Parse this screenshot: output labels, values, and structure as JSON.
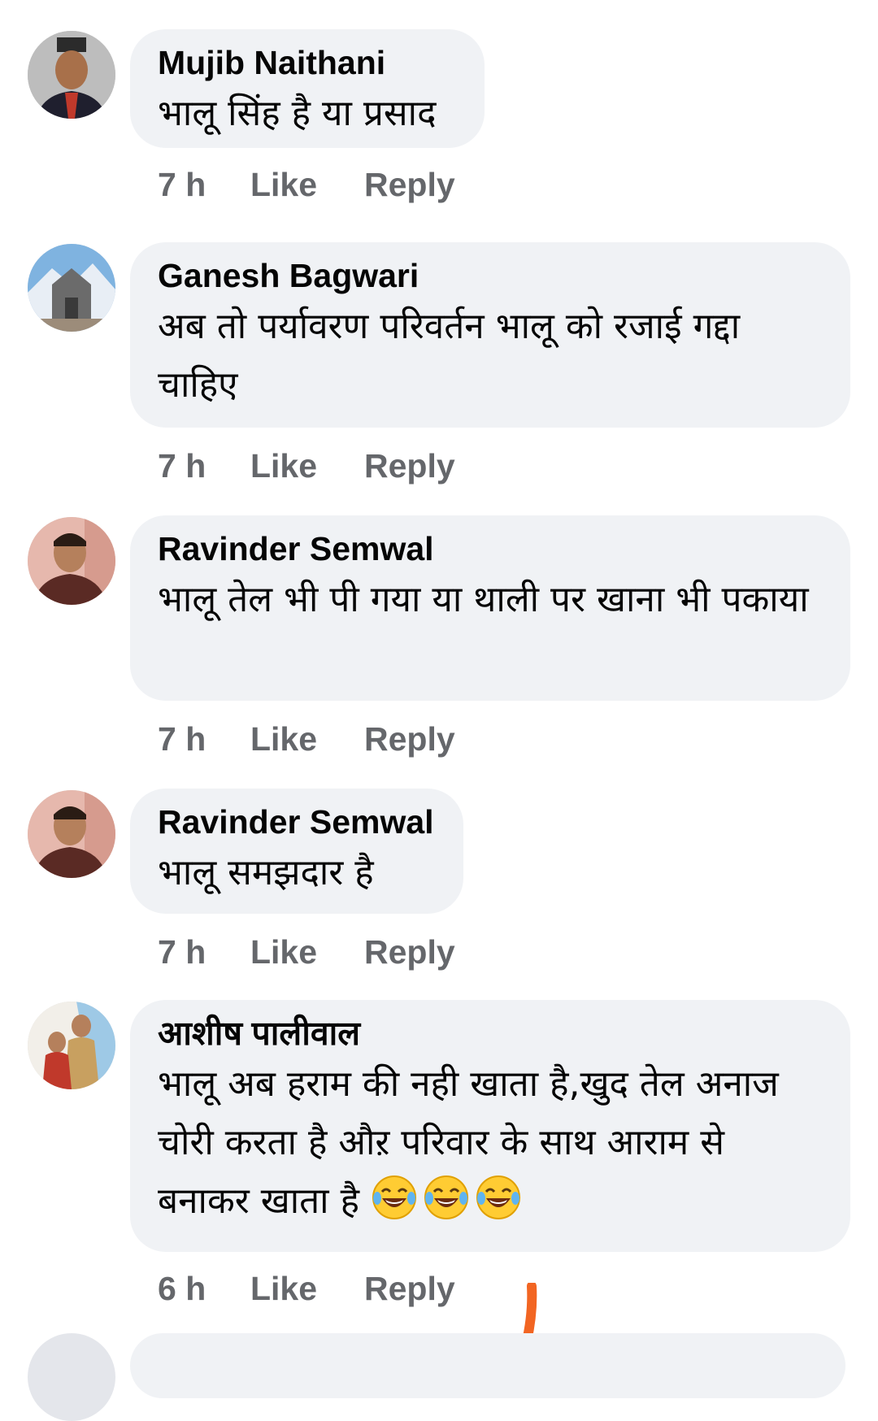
{
  "comments": [
    {
      "author": "Mujib Naithani",
      "text": "भालू सिंह है या प्रसाद",
      "time": "7 h",
      "like": "Like",
      "reply": "Reply"
    },
    {
      "author": "Ganesh Bagwari",
      "text": "अब तो पर्यावरण परिवर्तन भालू को रजाई गद्दा चाहिए",
      "time": "7 h",
      "like": "Like",
      "reply": "Reply"
    },
    {
      "author": "Ravinder Semwal",
      "text": "भालू तेल भी पी गया या थाली पर खाना भी पकाया",
      "time": "7 h",
      "like": "Like",
      "reply": "Reply"
    },
    {
      "author": "Ravinder Semwal",
      "text": "भालू समझदार है",
      "time": "7 h",
      "like": "Like",
      "reply": "Reply"
    },
    {
      "author": "आशीष पालीवाल",
      "text": "भालू अब हराम की नही खाता है,खुद तेल अनाज चोरी करता है औऱ परिवार के साथ आराम से बनाकर खाता है",
      "emoji": "😂😂😂",
      "time": "6 h",
      "like": "Like",
      "reply": "Reply"
    }
  ],
  "colors": {
    "bubble": "#f0f2f5",
    "meta": "#65676b",
    "text": "#050505",
    "mark": "#f26522"
  },
  "icons": [
    "avatar-photo",
    "tears-of-joy-emoji"
  ]
}
